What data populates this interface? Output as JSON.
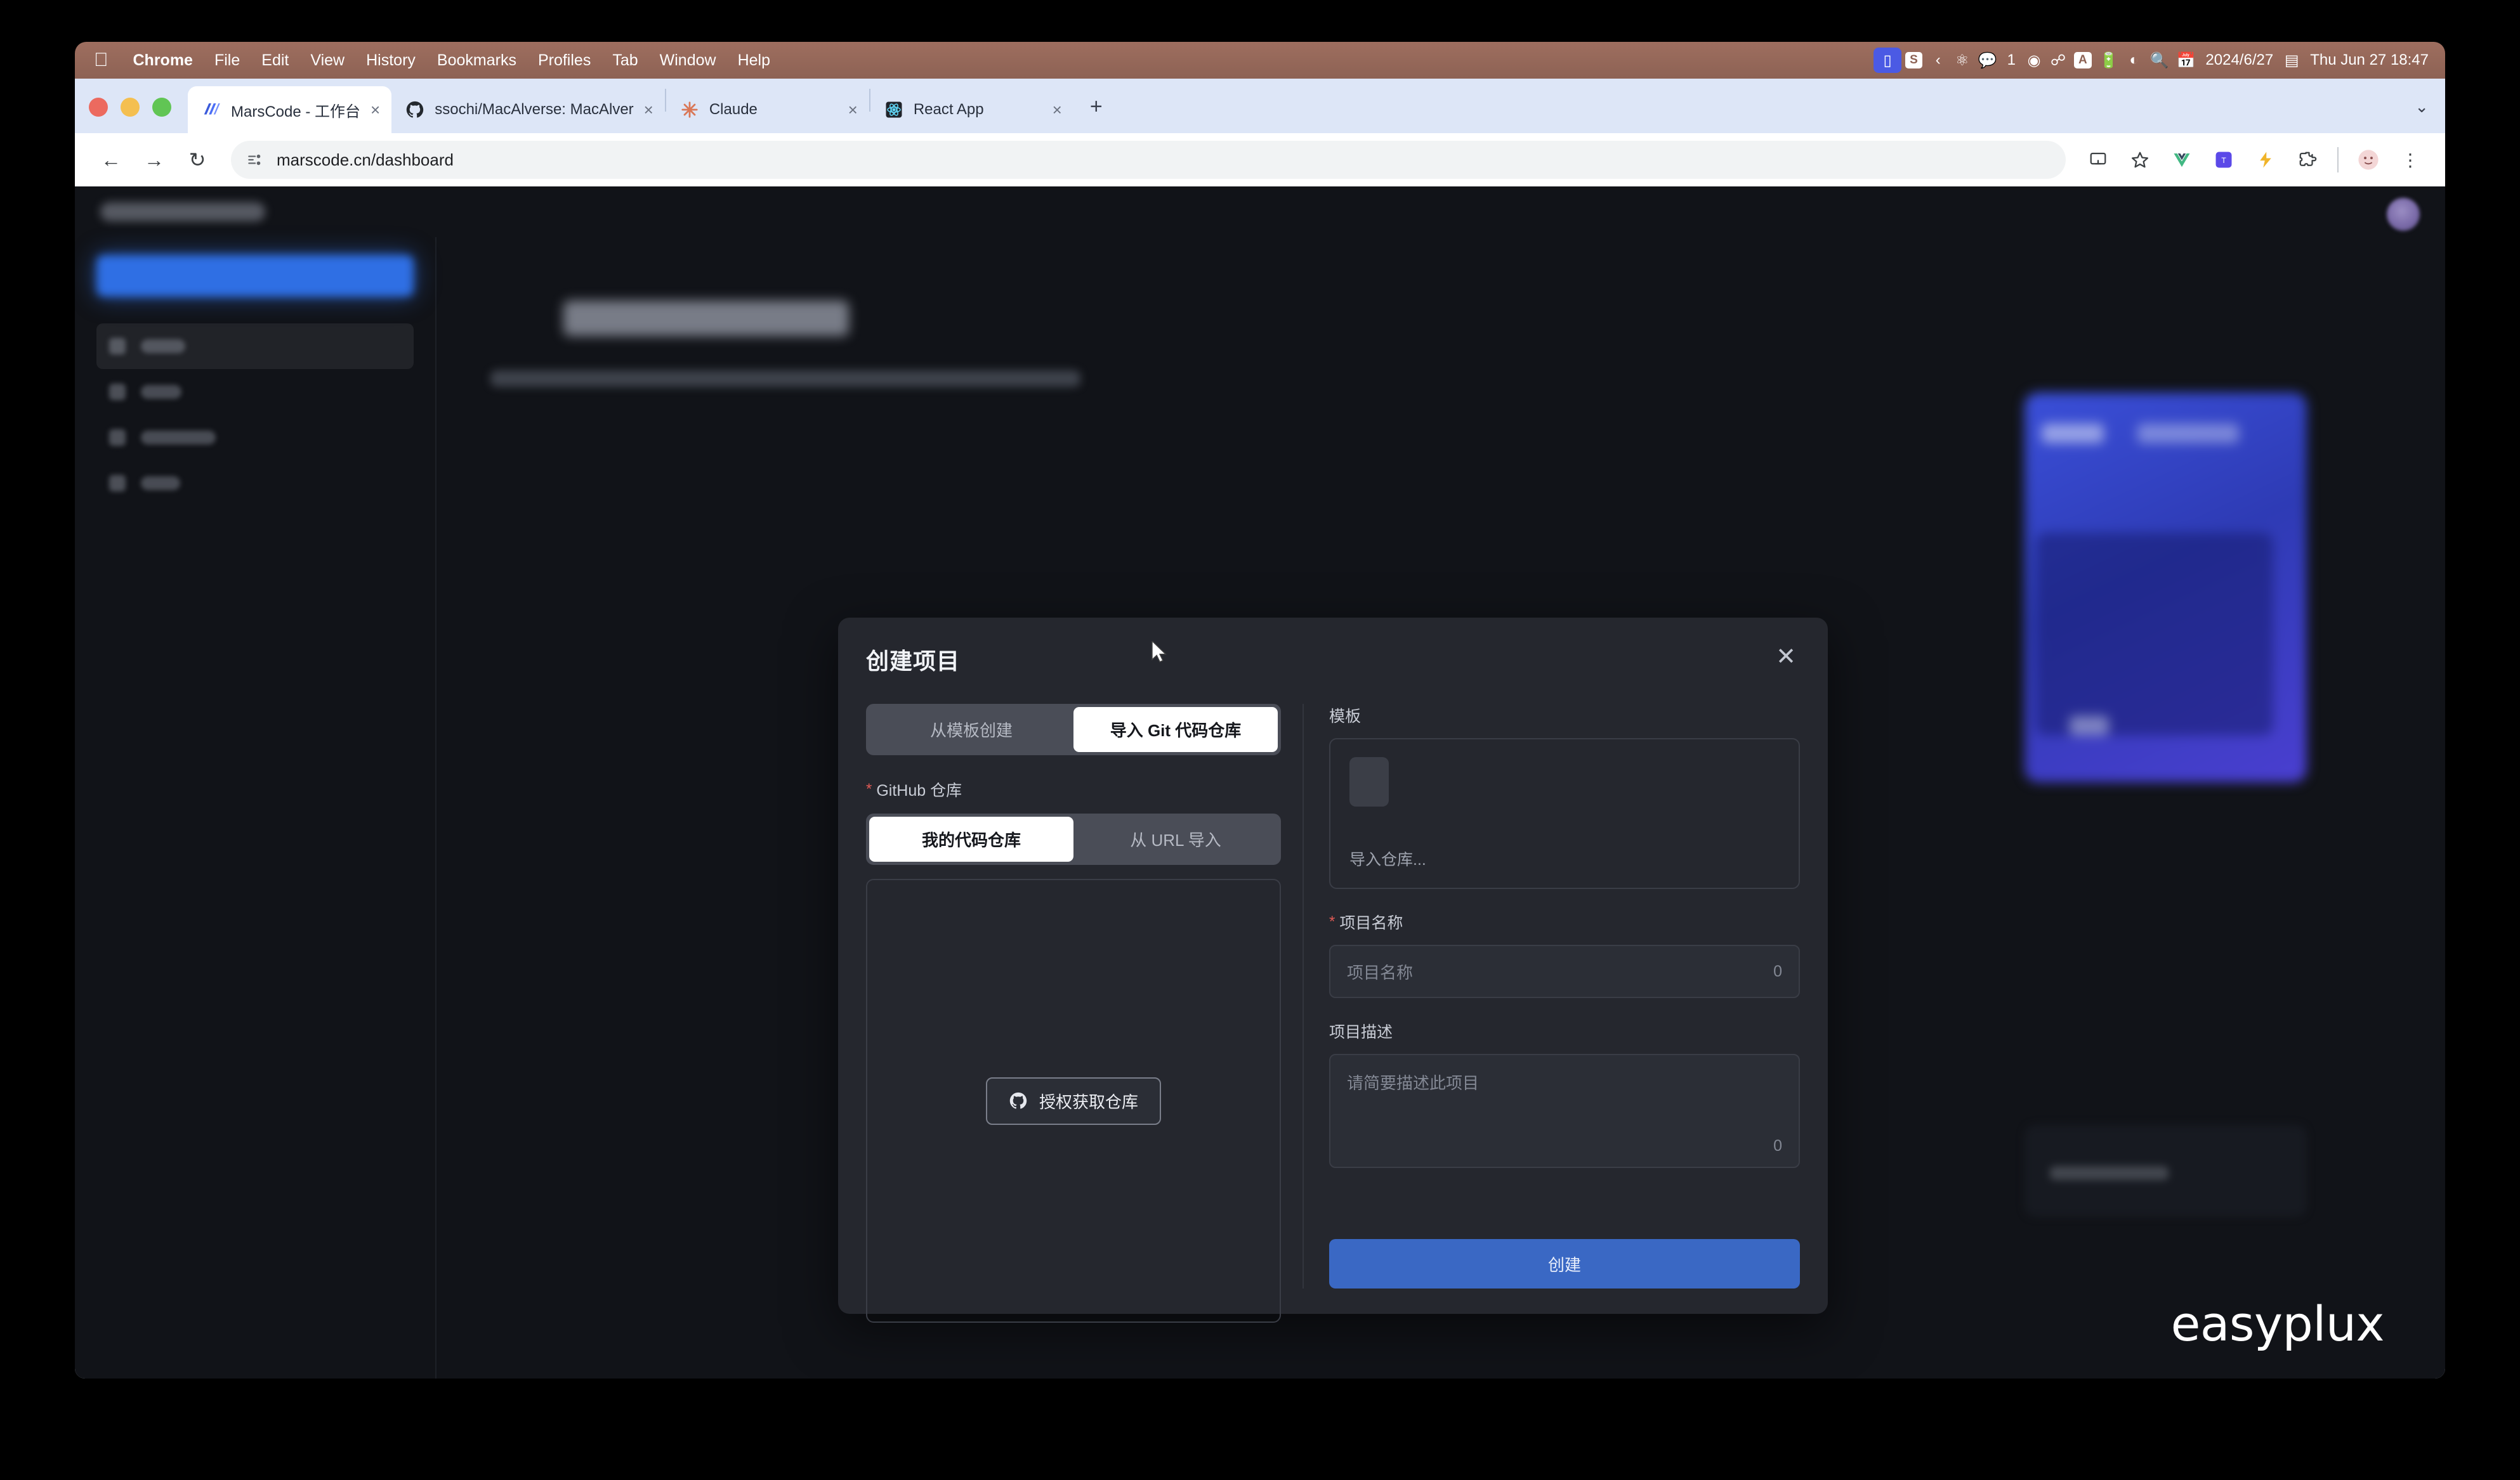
{
  "menubar": {
    "apple_icon": "apple-logo",
    "items": [
      {
        "label": "Chrome",
        "bold": true
      },
      {
        "label": "File",
        "bold": false
      },
      {
        "label": "Edit",
        "bold": false
      },
      {
        "label": "View",
        "bold": false
      },
      {
        "label": "History",
        "bold": false
      },
      {
        "label": "Bookmarks",
        "bold": false
      },
      {
        "label": "Profiles",
        "bold": false
      },
      {
        "label": "Tab",
        "bold": false
      },
      {
        "label": "Window",
        "bold": false
      },
      {
        "label": "Help",
        "bold": false
      }
    ],
    "status_icons": [
      "screen-recording-icon",
      "stats-s-icon",
      "chevron-left-icon",
      "brain-icon",
      "wechat-icon",
      "play-circle-icon",
      "bluetooth-icon",
      "input-source-a-icon",
      "battery-icon",
      "wifi-icon",
      "search-icon",
      "calendar-icon"
    ],
    "wechat_count": "1",
    "input_source": "A",
    "date": "2024/6/27",
    "control_center_icon": "control-center-icon",
    "clock": "Thu Jun 27  18:47"
  },
  "browser": {
    "tabs": [
      {
        "title": "MarsCode - 工作台",
        "favicon": "marscode-icon",
        "active": true
      },
      {
        "title": "ssochi/MacAlverse: MacAlver",
        "favicon": "github-icon",
        "active": false
      },
      {
        "title": "Claude",
        "favicon": "claude-icon",
        "active": false
      },
      {
        "title": "React App",
        "favicon": "react-icon",
        "active": false
      }
    ],
    "close_label": "×",
    "new_tab_label": "+",
    "tabstrip_overflow": "⌄",
    "back_icon": "back-arrow-icon",
    "forward_icon": "forward-arrow-icon",
    "reload_icon": "reload-icon",
    "url": "marscode.cn/dashboard",
    "site_icon": "page-info-icon",
    "toolbar_icons": [
      "cast-icon",
      "bookmark-star-icon",
      "vue-devtools-icon",
      "tango-extension-icon",
      "lightning-extension-icon",
      "extensions-puzzle-icon"
    ],
    "profile_icon": "profile-avatar-icon",
    "menu_icon": "chrome-menu-icon"
  },
  "page": {
    "watermark": "easyplux",
    "sidebar": {
      "cta_label": "",
      "items": [
        {
          "label": "",
          "active": true
        },
        {
          "label": "",
          "active": false
        },
        {
          "label": "",
          "active": false
        },
        {
          "label": "",
          "active": false
        }
      ]
    },
    "main": {
      "hero_title": "",
      "hero_subtitle": ""
    }
  },
  "modal": {
    "title": "创建项目",
    "close_label": "✕",
    "source_tabs": [
      {
        "label": "从模板创建",
        "active": false
      },
      {
        "label": "导入 Git 代码仓库",
        "active": true
      }
    ],
    "github": {
      "label": "GitHub 仓库",
      "required": "*",
      "tabs": [
        {
          "label": "我的代码仓库",
          "active": true
        },
        {
          "label": "从 URL 导入",
          "active": false
        }
      ],
      "authorize_button": "授权获取仓库",
      "authorize_icon": "github-icon"
    },
    "template": {
      "label": "模板",
      "card_name": "导入仓库..."
    },
    "project_name": {
      "label": "项目名称",
      "required": "*",
      "placeholder": "项目名称",
      "value": "",
      "counter": "0"
    },
    "project_desc": {
      "label": "项目描述",
      "placeholder": "请简要描述此项目",
      "value": "",
      "counter": "0"
    },
    "submit_label": "创建",
    "accent_color": "#3a68c4",
    "required_color": "#e05a55"
  }
}
